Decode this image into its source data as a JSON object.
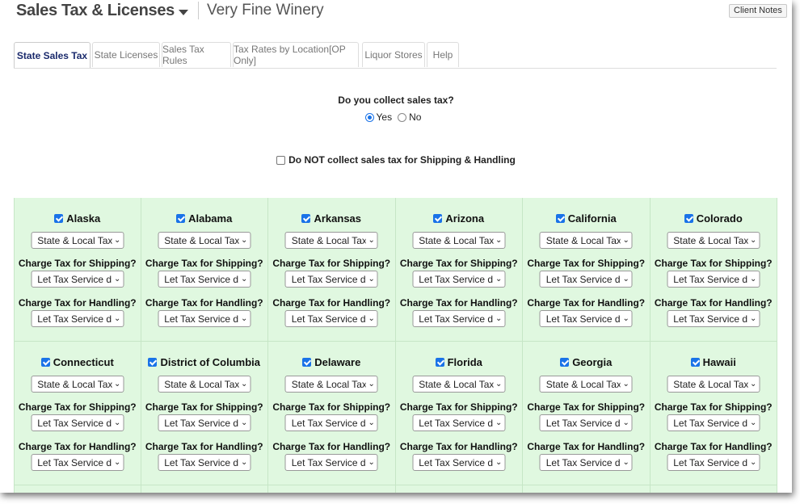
{
  "header": {
    "title": "Sales Tax & Licenses",
    "company": "Very Fine Winery",
    "client_notes": "Client Notes"
  },
  "tabs": [
    {
      "label": "State Sales Tax"
    },
    {
      "label": "State Licenses"
    },
    {
      "label": "Sales Tax Rules"
    },
    {
      "label": "Tax Rates by Location[OP Only]"
    },
    {
      "label": "Liquor Stores"
    },
    {
      "label": "Help"
    }
  ],
  "collect": {
    "question": "Do you collect sales tax?",
    "yes": "Yes",
    "no": "No",
    "selected": "Yes"
  },
  "shipping_option": {
    "label": "Do NOT collect sales tax for Shipping & Handling",
    "checked": false
  },
  "labels": {
    "shipping": "Charge Tax for Shipping?",
    "handling": "Charge Tax for Handling?"
  },
  "states": [
    {
      "name": "Alaska",
      "checked": true,
      "tax": "State & Local Taxes",
      "shipping": "Let Tax Service deci",
      "handling": "Let Tax Service deci"
    },
    {
      "name": "Alabama",
      "checked": true,
      "tax": "State & Local Taxes",
      "shipping": "Let Tax Service deci",
      "handling": "Let Tax Service deci"
    },
    {
      "name": "Arkansas",
      "checked": true,
      "tax": "State & Local Taxes",
      "shipping": "Let Tax Service deci",
      "handling": "Let Tax Service deci"
    },
    {
      "name": "Arizona",
      "checked": true,
      "tax": "State & Local Taxes",
      "shipping": "Let Tax Service deci",
      "handling": "Let Tax Service deci"
    },
    {
      "name": "California",
      "checked": true,
      "tax": "State & Local Taxes",
      "shipping": "Let Tax Service deci",
      "handling": "Let Tax Service deci"
    },
    {
      "name": "Colorado",
      "checked": true,
      "tax": "State & Local Taxes",
      "shipping": "Let Tax Service deci",
      "handling": "Let Tax Service deci"
    },
    {
      "name": "Connecticut",
      "checked": true,
      "tax": "State & Local Taxes",
      "shipping": "Let Tax Service deci",
      "handling": "Let Tax Service deci"
    },
    {
      "name": "District of Columbia",
      "checked": true,
      "tax": "State & Local Taxes",
      "shipping": "Let Tax Service deci",
      "handling": "Let Tax Service deci"
    },
    {
      "name": "Delaware",
      "checked": true,
      "tax": "State & Local Taxes",
      "shipping": "Let Tax Service deci",
      "handling": "Let Tax Service deci"
    },
    {
      "name": "Florida",
      "checked": true,
      "tax": "State & Local Taxes",
      "shipping": "Let Tax Service deci",
      "handling": "Let Tax Service deci"
    },
    {
      "name": "Georgia",
      "checked": true,
      "tax": "State & Local Taxes",
      "shipping": "Let Tax Service deci",
      "handling": "Let Tax Service deci"
    },
    {
      "name": "Hawaii",
      "checked": true,
      "tax": "State & Local Taxes",
      "shipping": "Let Tax Service deci",
      "handling": "Let Tax Service deci"
    }
  ],
  "colors": {
    "grid_bg": "#e0f8e0",
    "accent": "#1a73e8",
    "active_tab": "#1a2a6c"
  }
}
